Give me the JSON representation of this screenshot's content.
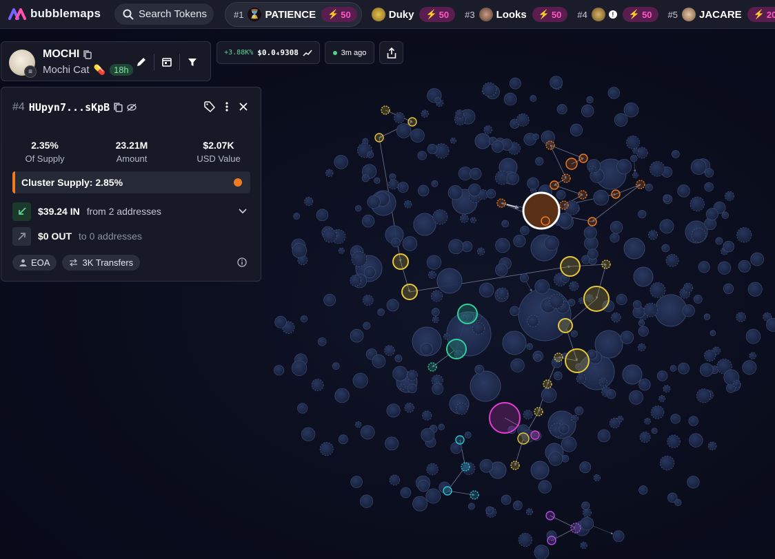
{
  "app": {
    "name": "bubblemaps"
  },
  "search": {
    "label": "Search Tokens"
  },
  "ticker": [
    {
      "rank": "#1",
      "name": "PATIENCE",
      "boost": "50",
      "active": true
    },
    {
      "rank": "",
      "name": "Duky",
      "boost": "50"
    },
    {
      "rank": "#3",
      "name": "Looks",
      "boost": "50"
    },
    {
      "rank": "#4",
      "name": "",
      "boost": "50"
    },
    {
      "rank": "#5",
      "name": "JACARE",
      "boost": "20"
    }
  ],
  "token": {
    "symbol": "MOCHI",
    "name": "Mochi Cat",
    "age": "18h",
    "price_change": "+3.88K%",
    "price": "$0.0₄9308",
    "updated": "3m ago"
  },
  "address_panel": {
    "rank": "#4",
    "address": "HUpyn7...sKpB",
    "stats": [
      {
        "value": "2.35%",
        "label": "Of Supply"
      },
      {
        "value": "23.21M",
        "label": "Amount"
      },
      {
        "value": "$2.07K",
        "label": "USD Value"
      }
    ],
    "cluster_supply": "Cluster Supply: 2.85%",
    "in_amount": "$39.24 IN",
    "in_from": "from 2 addresses",
    "out_amount": "$0 OUT",
    "out_to": "to 0 addresses",
    "tags": [
      "EOA",
      "3K Transfers"
    ]
  },
  "colors": {
    "accent_pink": "#ff58c4",
    "cluster_orange": "#f07b20",
    "cluster_yellow": "#e8c73a",
    "cluster_green": "#2fd19a",
    "cluster_magenta": "#e13ccf",
    "cluster_cyan": "#2fc3d6",
    "cluster_purple": "#b34fe8",
    "bubble_default": "#1e2a4a"
  }
}
